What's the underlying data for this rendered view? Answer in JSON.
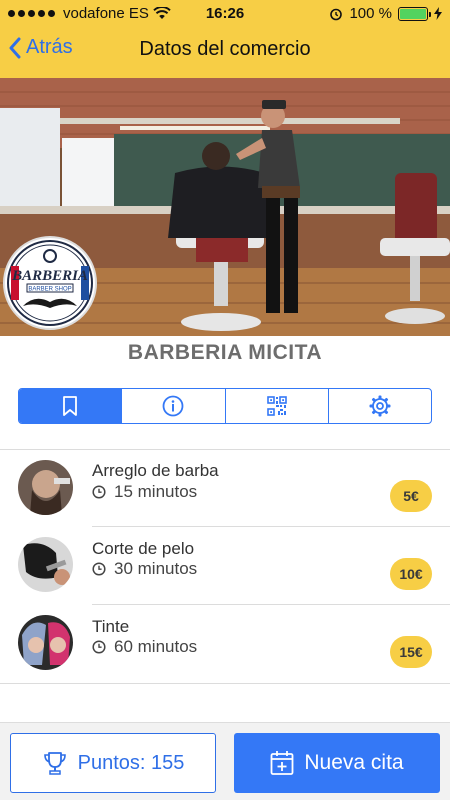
{
  "status_bar": {
    "carrier": "vodafone ES",
    "time": "16:26",
    "battery": "100 %",
    "battery_level": 1.0
  },
  "nav": {
    "back_label": "Atrás",
    "title": "Datos del comercio"
  },
  "shop": {
    "name": "BARBERIA MICITA",
    "logo_text": "BARBERIA",
    "logo_subtext": "BARBER SHOP"
  },
  "tabs": [
    {
      "icon": "bookmark-icon",
      "active": true
    },
    {
      "icon": "info-icon",
      "active": false
    },
    {
      "icon": "qr-code-icon",
      "active": false
    },
    {
      "icon": "gear-icon",
      "active": false
    }
  ],
  "services": [
    {
      "name": "Arreglo de barba",
      "duration": "15 minutos",
      "price": "5€"
    },
    {
      "name": "Corte de pelo",
      "duration": "30 minutos",
      "price": "10€"
    },
    {
      "name": "Tinte",
      "duration": "60 minutos",
      "price": "15€"
    }
  ],
  "bottom": {
    "points_label": "Puntos: 155",
    "new_appointment_label": "Nueva cita"
  },
  "colors": {
    "accent": "#3478f6",
    "header": "#f7ce45",
    "price_badge": "#f7ce45"
  }
}
